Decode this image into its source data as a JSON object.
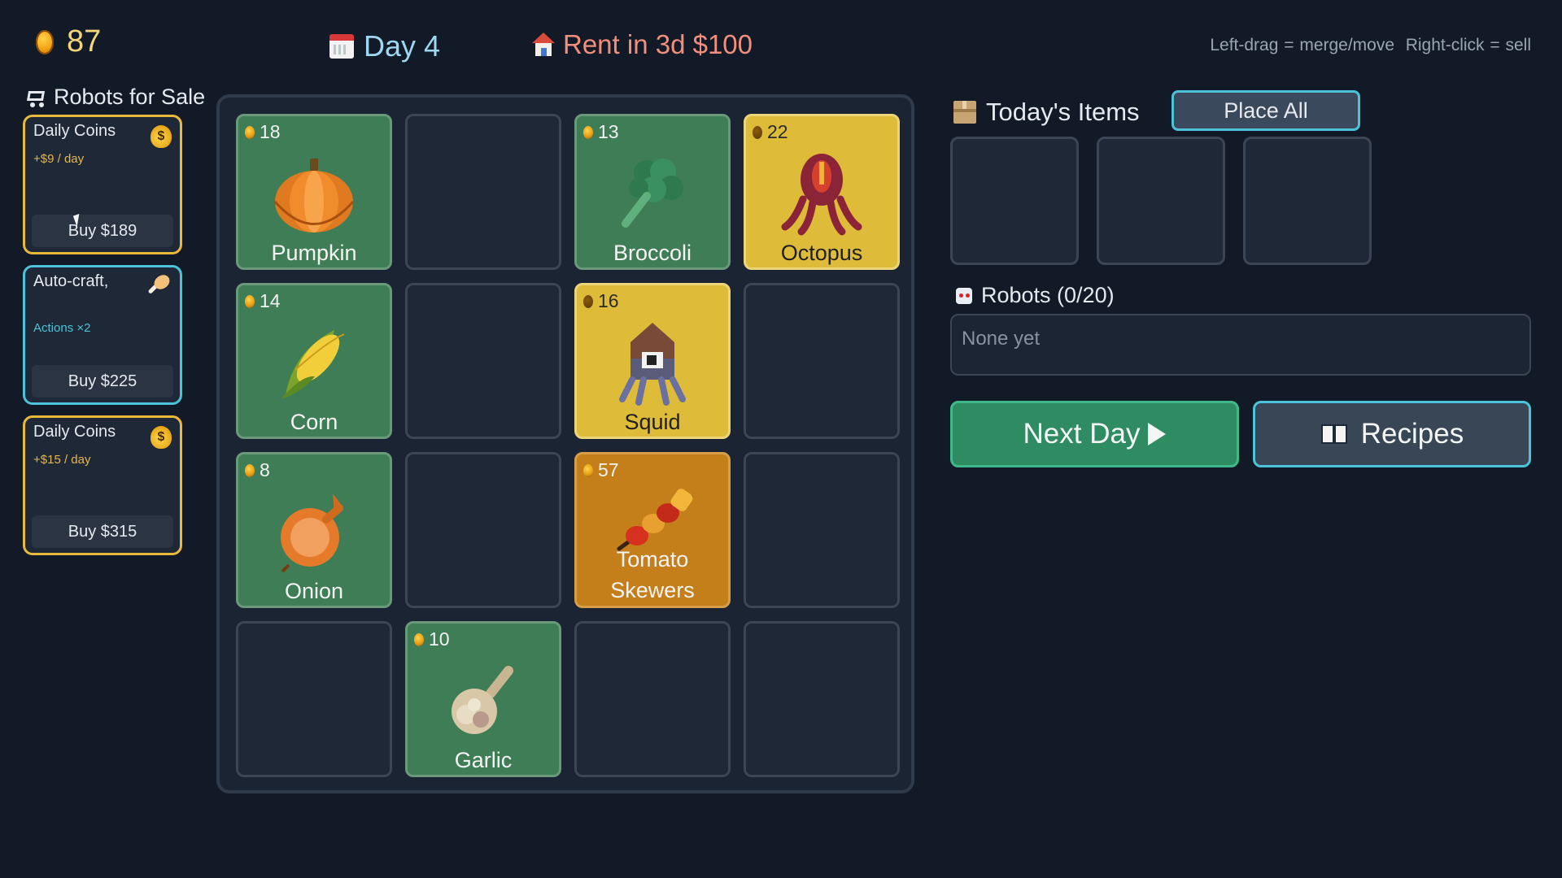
{
  "topbar": {
    "coins": "87",
    "day": "Day 4",
    "rent": "Rent in 3d $100",
    "hint": "Left-drag = merge/move  Right-click = sell"
  },
  "shop": {
    "title": "Robots for Sale",
    "cards": [
      {
        "name": "Daily Coins",
        "sub": "+$9 / day",
        "buy": "Buy $189",
        "icon": "money-bag-icon"
      },
      {
        "name": "Auto-craft,",
        "sub": "Actions ×2",
        "buy": "Buy $225",
        "icon": "drumstick-icon"
      },
      {
        "name": "Daily Coins",
        "sub": "+$15 / day",
        "buy": "Buy $315",
        "icon": "money-bag-icon"
      }
    ]
  },
  "board": {
    "cells": [
      {
        "name": "Pumpkin",
        "price": "18",
        "tier": "green"
      },
      null,
      {
        "name": "Broccoli",
        "price": "13",
        "tier": "green"
      },
      {
        "name": "Octopus",
        "price": "22",
        "tier": "yellow"
      },
      {
        "name": "Corn",
        "price": "14",
        "tier": "green"
      },
      null,
      {
        "name": "Squid",
        "price": "16",
        "tier": "yellow"
      },
      null,
      {
        "name": "Onion",
        "price": "8",
        "tier": "green"
      },
      null,
      {
        "name": "Tomato Skewers",
        "line1": "Tomato",
        "line2": "Skewers",
        "price": "57",
        "tier": "orange"
      },
      null,
      null,
      {
        "name": "Garlic",
        "price": "10",
        "tier": "green"
      },
      null,
      null
    ]
  },
  "todays_items": {
    "title": "Today's Items",
    "place_all": "Place All"
  },
  "robots": {
    "title": "Robots (0/20)",
    "empty": "None yet"
  },
  "actions": {
    "next_day": "Next Day",
    "recipes": "Recipes"
  },
  "colors": {
    "background": "#111a26",
    "green_tile": "#3e7d55",
    "yellow_tile": "#dfbb3a",
    "orange_tile": "#c47f1a",
    "gold_border": "#e9b93c",
    "cyan_border": "#4cc3d9",
    "next_day_green": "#2f8c62"
  }
}
